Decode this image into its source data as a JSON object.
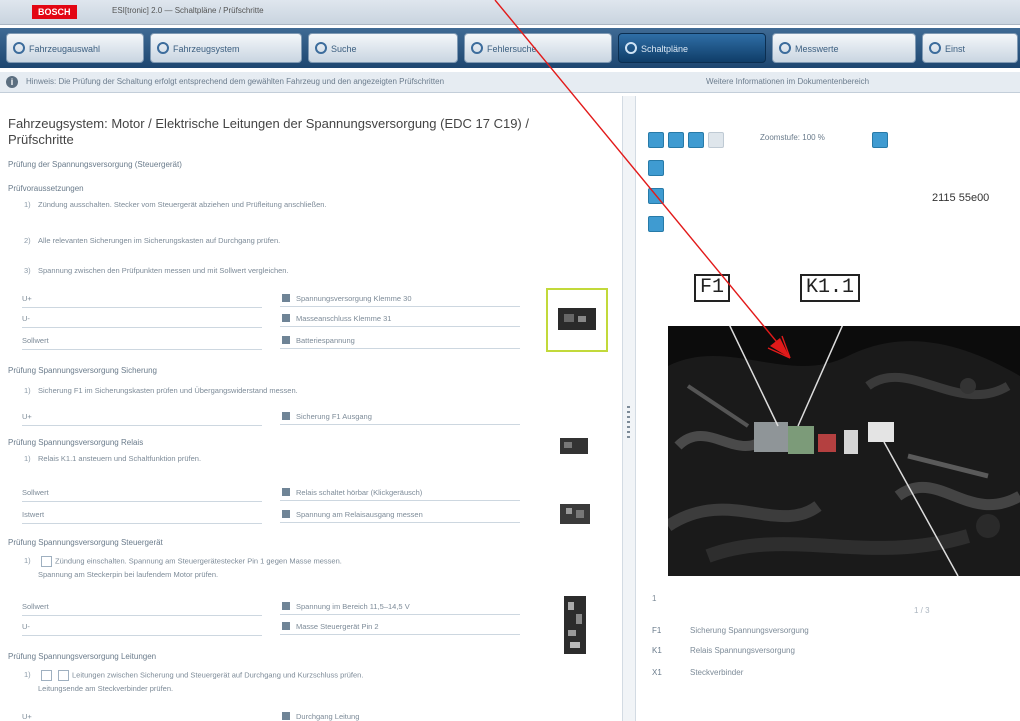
{
  "titlebar": {
    "brand": "BOSCH",
    "title": "ESI[tronic] 2.0 — Schaltpläne / Prüfschritte"
  },
  "nav": {
    "tabs": [
      {
        "label": "Fahrzeugauswahl",
        "icon": "car-icon"
      },
      {
        "label": "Fahrzeugsystem",
        "icon": "system-icon"
      },
      {
        "label": "Suche",
        "icon": "search-icon"
      },
      {
        "label": "Fehlersuche",
        "icon": "list-icon"
      },
      {
        "label": "Schaltpläne",
        "icon": "wrench-icon",
        "active": true
      },
      {
        "label": "Messwerte",
        "icon": "gauge-icon"
      },
      {
        "label": "Einst",
        "icon": "settings-icon"
      }
    ]
  },
  "infobar": {
    "text": "Hinweis: Die Prüfung der Schaltung erfolgt entsprechend dem gewählten Fahrzeug und den angezeigten Prüfschritten",
    "right_text": "Weitere Informationen im Dokumentenbereich"
  },
  "left": {
    "title": "Fahrzeugsystem: Motor / Elektrische Leitungen der Spannungsversorgung (EDC 17 C19) / Prüfschritte",
    "subtitle": "Prüfung der Spannungsversorgung (Steuergerät)",
    "sections": [
      {
        "heading": "Prüfvoraussetzungen",
        "lines": [
          "Zündung ausschalten. Stecker vom Steuergerät abziehen und Prüfleitung anschließen.",
          "Alle relevanten Sicherungen im Sicherungskasten auf Durchgang prüfen.",
          "Spannung zwischen den Prüfpunkten messen und mit Sollwert vergleichen."
        ],
        "rows": [
          {
            "label": "U+",
            "value": "Spannungsversorgung Klemme 30"
          },
          {
            "label": "U-",
            "value": "Masseanschluss Klemme 31"
          },
          {
            "label": "Sollwert",
            "value": "Batteriespannung"
          }
        ]
      },
      {
        "heading": "Prüfung Spannungsversorgung Sicherung",
        "lines": [
          "Sicherung F1 im Sicherungskasten prüfen und Übergangswiderstand messen."
        ],
        "rows": [
          {
            "label": "U+",
            "value": "Sicherung F1 Ausgang"
          }
        ]
      },
      {
        "heading": "Prüfung Spannungsversorgung Relais",
        "lines": [
          "Relais K1.1 ansteuern und Schaltfunktion prüfen."
        ],
        "rows": [
          {
            "label": "Sollwert",
            "value": "Relais schaltet hörbar (Klickgeräusch)"
          },
          {
            "label": "Istwert",
            "value": "Spannung am Relaisausgang messen"
          }
        ]
      },
      {
        "heading": "Prüfung Spannungsversorgung Steuergerät",
        "lines": [
          "Zündung einschalten. Spannung am Steuergerätestecker Pin 1 gegen Masse messen.",
          "Spannung am Steckerpin bei laufendem Motor prüfen."
        ],
        "rows": [
          {
            "label": "Sollwert",
            "value": "Spannung im Bereich 11,5–14,5 V"
          },
          {
            "label": "U-",
            "value": "Masse Steuergerät Pin 2"
          }
        ]
      },
      {
        "heading": "Prüfung Spannungsversorgung Leitungen",
        "lines": [
          "Leitungen zwischen Sicherung und Steuergerät auf Durchgang und Kurzschluss prüfen.",
          "Leitungsende am Steckverbinder prüfen."
        ],
        "rows": [
          {
            "label": "U+",
            "value": "Durchgang Leitung"
          }
        ]
      }
    ]
  },
  "right": {
    "zoom_label": "Zoomstufe: 100 %",
    "doc_id": "2115 55e00",
    "callouts": [
      "F1",
      "K1.1"
    ],
    "legend": [
      {
        "code": "F1",
        "text": "Sicherung Spannungsversorgung"
      },
      {
        "code": "K1",
        "text": "Relais Spannungsversorgung"
      },
      {
        "code": "X1",
        "text": "Steckverbinder"
      }
    ],
    "pager": "1 / 3",
    "legend_num": "1"
  }
}
